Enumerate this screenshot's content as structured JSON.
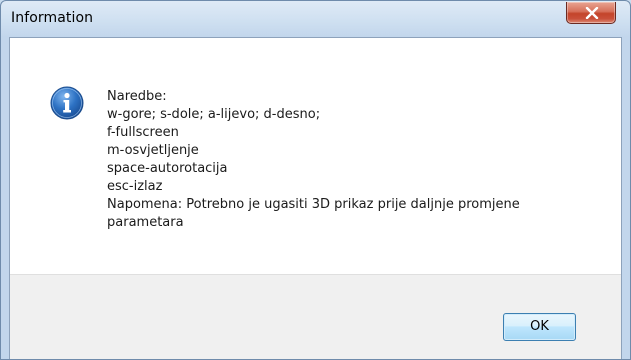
{
  "window": {
    "title": "Information",
    "close_icon": "close-x-icon"
  },
  "dialog": {
    "icon": "info-icon",
    "message_lines": [
      "Naredbe:",
      "w-gore; s-dole; a-lijevo; d-desno;",
      "f-fullscreen",
      "m-osvjetljenje",
      "space-autorotacija",
      "esc-izlaz",
      "Napomena: Potrebno je ugasiti 3D prikaz prije daljnje promjene",
      "parametara"
    ],
    "ok_label": "OK"
  },
  "colors": {
    "frame": "#c2d6ec",
    "close_button": "#c4442a",
    "info_icon": "#1f63b5",
    "ok_button_border": "#3c7fb1"
  }
}
